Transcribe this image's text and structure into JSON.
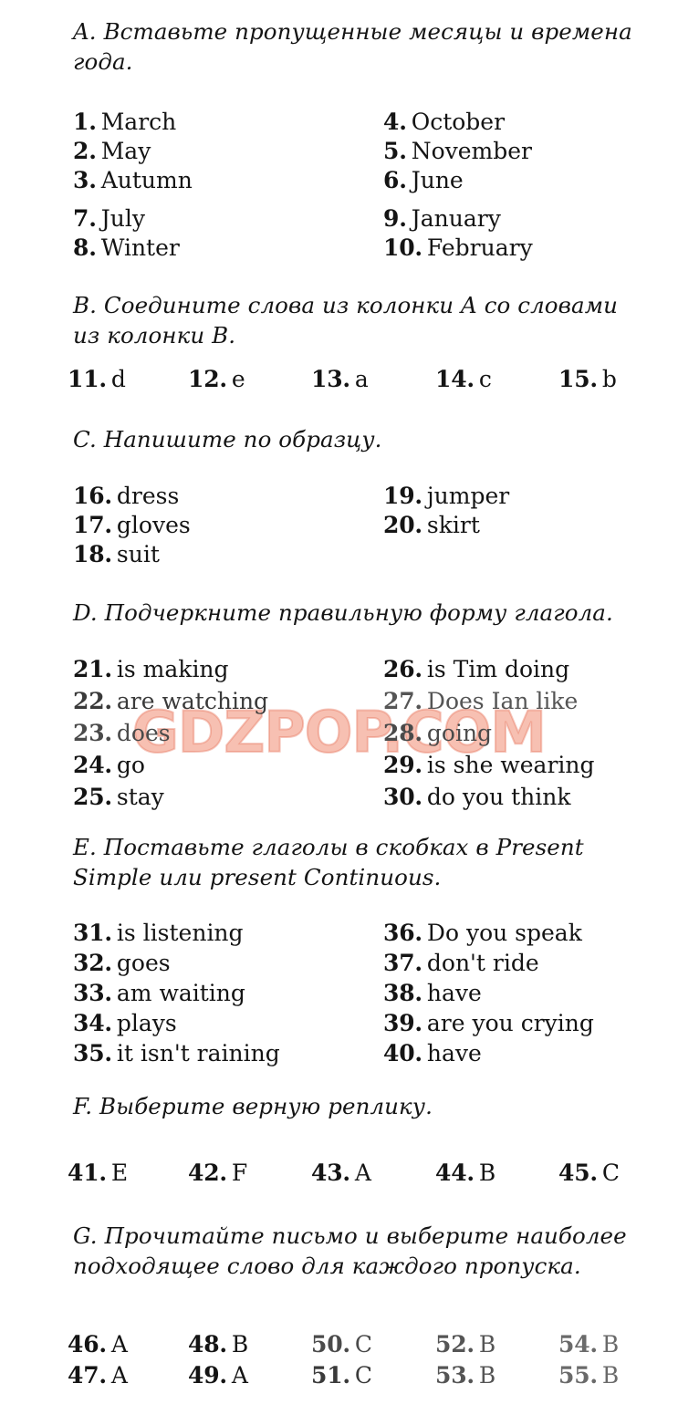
{
  "page": {
    "background": "#ffffff",
    "text_color": "#141414",
    "watermark": {
      "text": "GDZPOP.COM",
      "color": "#f08c73"
    }
  },
  "sections": [
    {
      "id": "A",
      "heading": "A. Вставьте пропущенные месяцы и времена года.",
      "layout": "two-column",
      "left": [
        {
          "num": "1.",
          "val": "March"
        },
        {
          "num": "2.",
          "val": "May"
        },
        {
          "num": "3.",
          "val": "Autumn"
        },
        {
          "num": "7.",
          "val": "July"
        },
        {
          "num": "8.",
          "val": "Winter"
        }
      ],
      "right": [
        {
          "num": "4.",
          "val": "October"
        },
        {
          "num": "5.",
          "val": "November"
        },
        {
          "num": "6.",
          "val": "June"
        },
        {
          "num": "9.",
          "val": "January"
        },
        {
          "num": "10.",
          "val": "February"
        }
      ]
    },
    {
      "id": "B",
      "heading": "B. Соедините слова из колонки A со словами из колонки B.",
      "layout": "inline-row",
      "row": [
        {
          "num": "11.",
          "val": "d"
        },
        {
          "num": "12.",
          "val": "e"
        },
        {
          "num": "13.",
          "val": "a"
        },
        {
          "num": "14.",
          "val": "c"
        },
        {
          "num": "15.",
          "val": "b"
        }
      ]
    },
    {
      "id": "C",
      "heading": "C. Напишите по образцу.",
      "layout": "two-column",
      "left": [
        {
          "num": "16.",
          "val": "dress"
        },
        {
          "num": "17.",
          "val": "gloves"
        },
        {
          "num": "18.",
          "val": "suit"
        }
      ],
      "right": [
        {
          "num": "19.",
          "val": "jumper"
        },
        {
          "num": "20.",
          "val": "skirt"
        }
      ]
    },
    {
      "id": "D",
      "heading": "D. Подчеркните правильную форму глагола.",
      "layout": "two-column",
      "left": [
        {
          "num": "21.",
          "val": "is making"
        },
        {
          "num": "22.",
          "val": "are watching"
        },
        {
          "num": "23.",
          "val": "does"
        },
        {
          "num": "24.",
          "val": "go"
        },
        {
          "num": "25.",
          "val": "stay"
        }
      ],
      "right": [
        {
          "num": "26.",
          "val": "is Tim doing"
        },
        {
          "num": "27.",
          "val": "Does Ian like"
        },
        {
          "num": "28.",
          "val": "going"
        },
        {
          "num": "29.",
          "val": "is she wearing"
        },
        {
          "num": "30.",
          "val": "do you think"
        }
      ]
    },
    {
      "id": "E",
      "heading": "E. Поставьте глаголы в скобках в Present Simple или present Continuous.",
      "layout": "two-column",
      "left": [
        {
          "num": "31.",
          "val": "is listening"
        },
        {
          "num": "32.",
          "val": "goes"
        },
        {
          "num": "33.",
          "val": "am waiting"
        },
        {
          "num": "34.",
          "val": "plays"
        },
        {
          "num": "35.",
          "val": "it isn't raining"
        }
      ],
      "right": [
        {
          "num": "36.",
          "val": "Do you speak"
        },
        {
          "num": "37.",
          "val": "don't ride"
        },
        {
          "num": "38.",
          "val": "have"
        },
        {
          "num": "39.",
          "val": "are you crying"
        },
        {
          "num": "40.",
          "val": "have"
        }
      ]
    },
    {
      "id": "F",
      "heading": "F. Выберите верную реплику.",
      "layout": "inline-row",
      "row": [
        {
          "num": "41.",
          "val": "E"
        },
        {
          "num": "42.",
          "val": "F"
        },
        {
          "num": "43.",
          "val": "A"
        },
        {
          "num": "44.",
          "val": "B"
        },
        {
          "num": "45.",
          "val": "C"
        }
      ]
    },
    {
      "id": "G",
      "heading": "G. Прочитайте письмо и выберите наиболее подходящее слово для каждого пропуска.",
      "layout": "grid-5x2",
      "row1": [
        {
          "num": "46.",
          "val": "A"
        },
        {
          "num": "48.",
          "val": "B"
        },
        {
          "num": "50.",
          "val": "C"
        },
        {
          "num": "52.",
          "val": "B"
        },
        {
          "num": "54.",
          "val": "B"
        }
      ],
      "row2": [
        {
          "num": "47.",
          "val": "A"
        },
        {
          "num": "49.",
          "val": "A"
        },
        {
          "num": "51.",
          "val": "C"
        },
        {
          "num": "53.",
          "val": "B"
        },
        {
          "num": "55.",
          "val": "B"
        }
      ]
    }
  ]
}
